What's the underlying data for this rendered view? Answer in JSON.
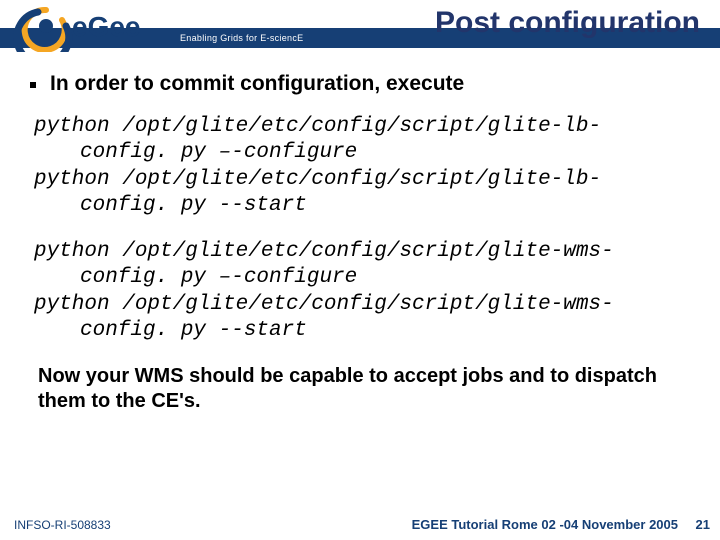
{
  "header": {
    "title": "Post configuration",
    "tagline": "Enabling Grids for E-sciencE",
    "logo_alt": "egee"
  },
  "bullet1": "In order to commit configuration, execute",
  "code1": {
    "l1a": "python /opt/glite/etc/config/script/glite-lb-",
    "l1b": "config. py –-configure",
    "l2a": "python /opt/glite/etc/config/script/glite-lb-",
    "l2b": "config. py --start"
  },
  "code2": {
    "l1a": "python /opt/glite/etc/config/script/glite-wms-",
    "l1b": "config. py –-configure",
    "l2a": "python /opt/glite/etc/config/script/glite-wms-",
    "l2b": "config. py --start"
  },
  "closing": "Now your WMS should be capable to accept jobs and to dispatch them to the CE's.",
  "footer": {
    "left": "INFSO-RI-508833",
    "right": "EGEE Tutorial Rome 02 -04 November 2005",
    "page": "21"
  }
}
